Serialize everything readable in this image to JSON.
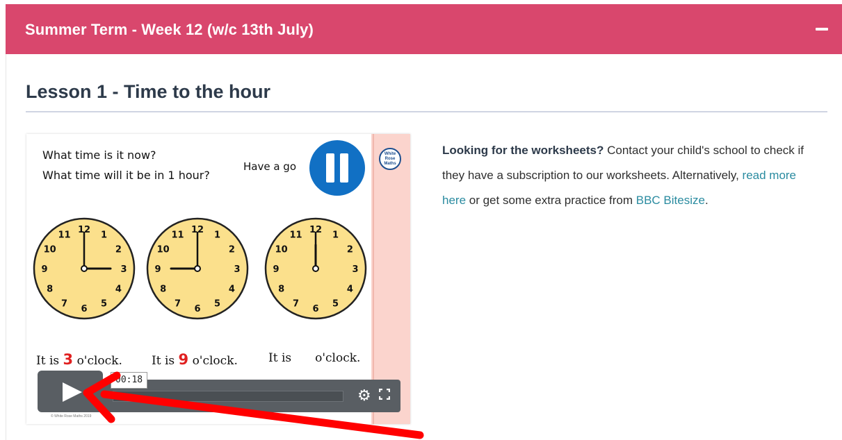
{
  "header": {
    "title": "Summer Term - Week 12 (w/c 13th July)",
    "collapse_icon": "minus-icon"
  },
  "lesson": {
    "title": "Lesson 1 - Time to the hour"
  },
  "video": {
    "question_line1": "What time is it now?",
    "question_line2": "What time will it be in 1 hour?",
    "have_a_go": "Have a go",
    "logo_text": "White Rose Maths",
    "answers": [
      {
        "prefix": "It is",
        "number": "3",
        "suffix": "o'clock."
      },
      {
        "prefix": "It is",
        "number": "9",
        "suffix": "o'clock."
      },
      {
        "prefix": "It is",
        "number": "",
        "suffix": "o'clock."
      }
    ],
    "clock_numbers": [
      "12",
      "1",
      "2",
      "3",
      "4",
      "5",
      "6",
      "7",
      "8",
      "9",
      "10",
      "11"
    ],
    "copyright": "© White Rose Maths 2019",
    "time_tooltip": "00:18",
    "play_icon": "play-icon",
    "settings_icon": "gear-icon",
    "fullscreen_icon": "fullscreen-icon",
    "pause_icon": "pause-icon"
  },
  "info": {
    "bold": "Looking for the worksheets?",
    "text1": " Contact your child's school to check if they have a subscription to our worksheets. Alternatively, ",
    "link1": "read more here",
    "text2": " or get some extra practice from ",
    "link2": "BBC Bitesize",
    "text3": "."
  },
  "colors": {
    "header_bg": "#d9476d",
    "link": "#2a8ba0",
    "clock_face": "#fbe08c",
    "pause_blue": "#1170c4",
    "annotation_arrow": "#ff0000"
  }
}
